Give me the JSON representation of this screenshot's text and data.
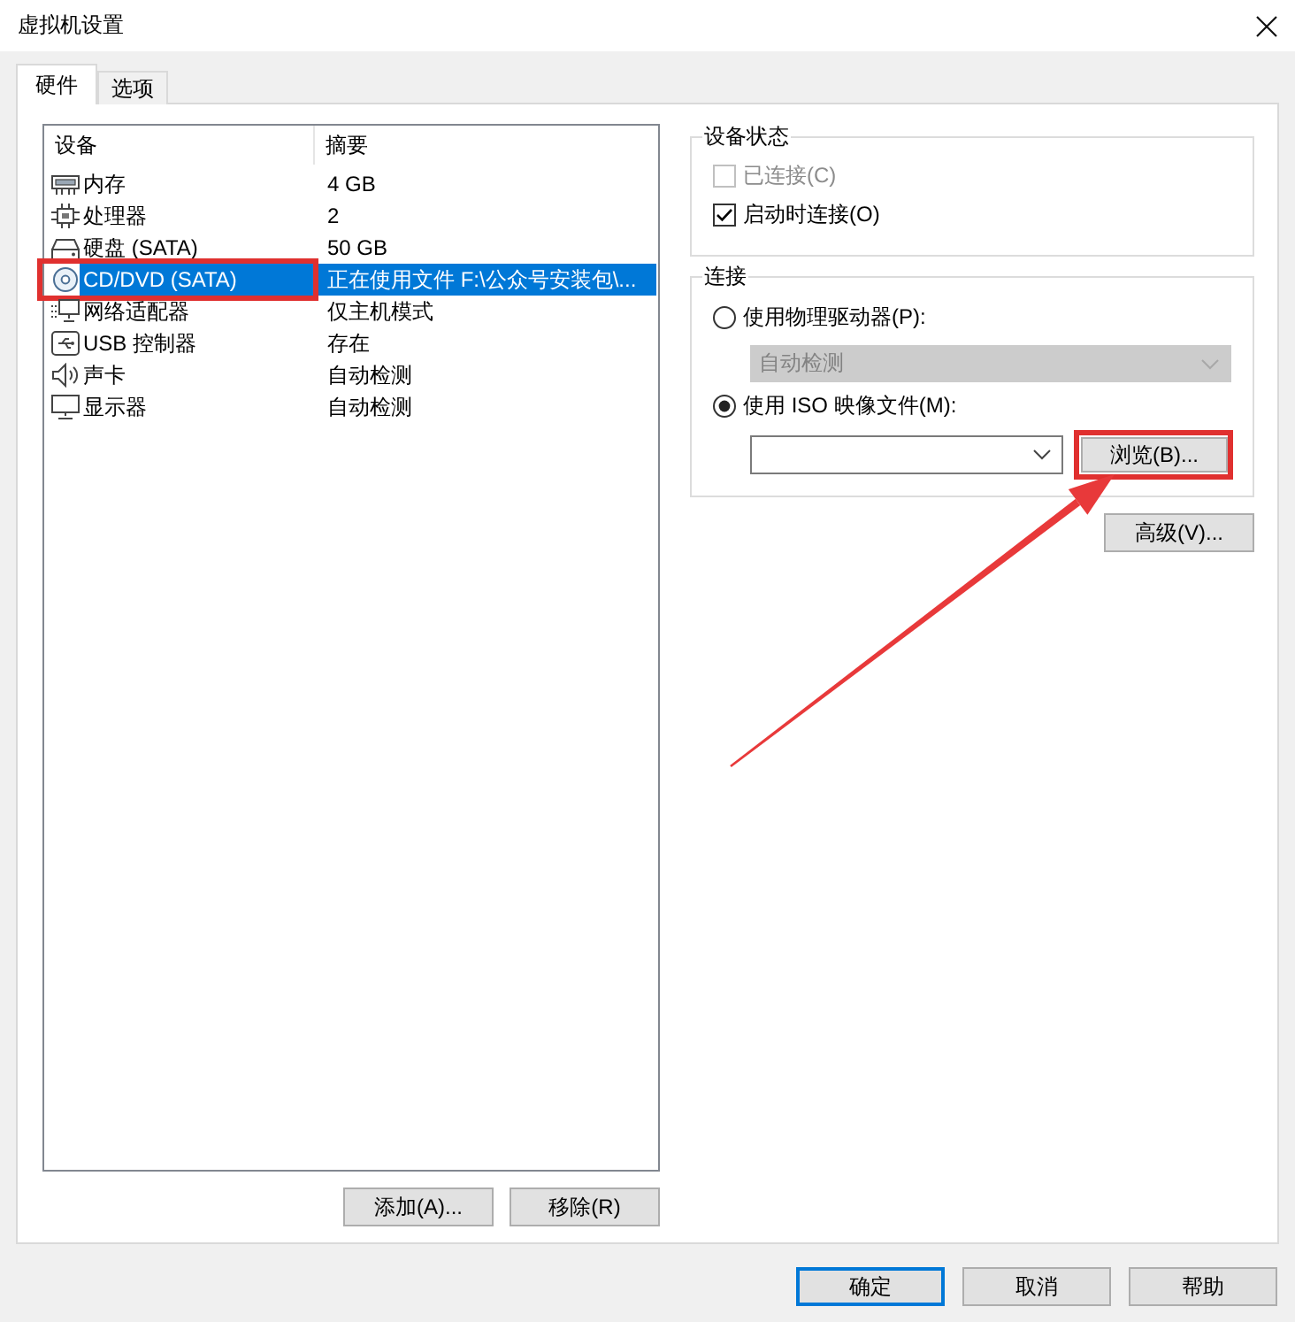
{
  "window": {
    "title": "虚拟机设置"
  },
  "tabs": [
    {
      "label": "硬件",
      "selected": true
    },
    {
      "label": "选项",
      "selected": false
    }
  ],
  "device_list": {
    "columns": [
      "设备",
      "摘要"
    ],
    "rows": [
      {
        "kind": "memory",
        "device": "内存",
        "summary": "4 GB",
        "selected": false,
        "marked": false
      },
      {
        "kind": "cpu",
        "device": "处理器",
        "summary": "2",
        "selected": false,
        "marked": false
      },
      {
        "kind": "disk",
        "device": "硬盘 (SATA)",
        "summary": "50 GB",
        "selected": false,
        "marked": false
      },
      {
        "kind": "cd",
        "device": "CD/DVD (SATA)",
        "summary": "正在使用文件 F:\\公众号安装包\\...",
        "selected": true,
        "marked": true
      },
      {
        "kind": "network",
        "device": "网络适配器",
        "summary": "仅主机模式",
        "selected": false,
        "marked": false
      },
      {
        "kind": "usb",
        "device": "USB 控制器",
        "summary": "存在",
        "selected": false,
        "marked": false
      },
      {
        "kind": "sound",
        "device": "声卡",
        "summary": "自动检测",
        "selected": false,
        "marked": false
      },
      {
        "kind": "display",
        "device": "显示器",
        "summary": "自动检测",
        "selected": false,
        "marked": false
      }
    ]
  },
  "list_buttons": [
    "添加(A)...",
    "移除(R)"
  ],
  "device_status": {
    "title": "设备状态",
    "options": [
      {
        "label": "已连接(C)",
        "checked": false,
        "disabled": true
      },
      {
        "label": "启动时连接(O)",
        "checked": true,
        "disabled": false
      }
    ]
  },
  "connection": {
    "title": "连接",
    "items": [
      {
        "kind": "radio",
        "label": "使用物理驱动器(P):",
        "selected": false
      },
      {
        "kind": "select",
        "value": "自动检测",
        "disabled": true
      },
      {
        "kind": "radio",
        "label": "使用 ISO 映像文件(M):",
        "selected": true
      },
      {
        "kind": "file",
        "button": "浏览(B)...",
        "marked": true
      }
    ]
  },
  "advanced_button": "高级(V)...",
  "dialog_buttons": [
    {
      "label": "确定",
      "default": true
    },
    {
      "label": "取消",
      "default": false
    },
    {
      "label": "帮助",
      "default": false
    }
  ]
}
